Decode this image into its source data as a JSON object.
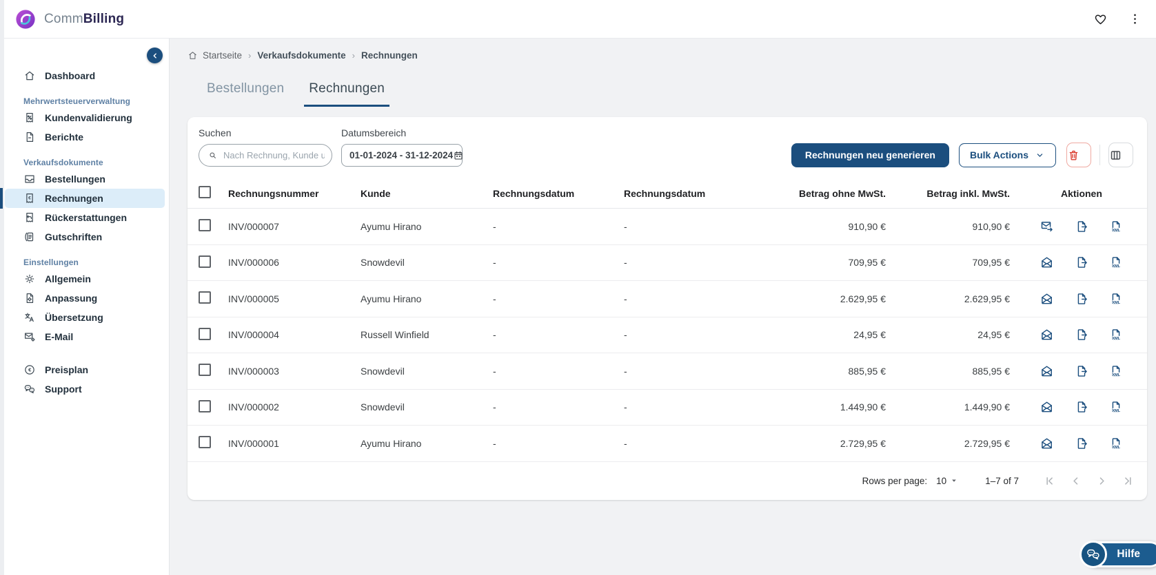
{
  "header": {
    "logo_prefix": "Comm",
    "logo_suffix": "Billing"
  },
  "sidebar": {
    "sections": [
      {
        "header": null,
        "items": [
          {
            "label": "Dashboard",
            "icon": "home-icon"
          }
        ]
      },
      {
        "header": "Mehrwertsteuerverwaltung",
        "items": [
          {
            "label": "Kundenvalidierung",
            "icon": "receipt-percent-icon"
          },
          {
            "label": "Berichte",
            "icon": "document-icon"
          }
        ]
      },
      {
        "header": "Verkaufsdokumente",
        "items": [
          {
            "label": "Bestellungen",
            "icon": "inbox-icon"
          },
          {
            "label": "Rechnungen",
            "icon": "invoice-euro-icon",
            "active": true
          },
          {
            "label": "Rückerstattungen",
            "icon": "refund-icon"
          },
          {
            "label": "Gutschriften",
            "icon": "credit-note-icon"
          }
        ]
      },
      {
        "header": "Einstellungen",
        "items": [
          {
            "label": "Allgemein",
            "icon": "gear-icon"
          },
          {
            "label": "Anpassung",
            "icon": "document-gear-icon"
          },
          {
            "label": "Übersetzung",
            "icon": "translate-icon"
          },
          {
            "label": "E-Mail",
            "icon": "mail-gear-icon"
          }
        ]
      },
      {
        "header": null,
        "gap": true,
        "items": [
          {
            "label": "Preisplan",
            "icon": "euro-circle-icon"
          },
          {
            "label": "Support",
            "icon": "chat-icon"
          }
        ]
      }
    ]
  },
  "breadcrumb": {
    "separator": "›",
    "items": [
      {
        "label": "Startseite",
        "icon": "home-icon",
        "bold": false
      },
      {
        "label": "Verkaufsdokumente",
        "bold": true
      },
      {
        "label": "Rechnungen",
        "bold": true
      }
    ]
  },
  "tabs": [
    {
      "label": "Bestellungen",
      "active": false
    },
    {
      "label": "Rechnungen",
      "active": true
    }
  ],
  "filters": {
    "search_label": "Suchen",
    "search_placeholder": "Nach Rechnung, Kunde u",
    "date_label": "Datumsbereich",
    "date_value": "01-01-2024 - 31-12-2024"
  },
  "toolbar": {
    "regenerate_label": "Rechnungen neu generieren",
    "bulk_label": "Bulk Actions"
  },
  "table": {
    "columns": [
      "Rechnungsnummer",
      "Kunde",
      "Rechnungsdatum",
      "Rechnungsdatum",
      "Betrag ohne MwSt.",
      "Betrag inkl. MwSt.",
      "Aktionen"
    ],
    "rows": [
      {
        "number": "INV/000007",
        "customer": "Ayumu Hirano",
        "date1": "-",
        "date2": "-",
        "net": "910,90 €",
        "gross": "910,90 €",
        "actions": [
          "mail-send-icon",
          "file-export-icon",
          "file-xml-icon"
        ]
      },
      {
        "number": "INV/000006",
        "customer": "Snowdevil",
        "date1": "-",
        "date2": "-",
        "net": "709,95 €",
        "gross": "709,95 €",
        "actions": [
          "mail-open-icon",
          "file-export-icon",
          "file-xml-icon"
        ]
      },
      {
        "number": "INV/000005",
        "customer": "Ayumu Hirano",
        "date1": "-",
        "date2": "-",
        "net": "2.629,95 €",
        "gross": "2.629,95 €",
        "actions": [
          "mail-open-icon",
          "file-export-icon",
          "file-xml-icon"
        ]
      },
      {
        "number": "INV/000004",
        "customer": "Russell Winfield",
        "date1": "-",
        "date2": "-",
        "net": "24,95 €",
        "gross": "24,95 €",
        "actions": [
          "mail-open-icon",
          "file-export-icon",
          "file-xml-icon"
        ]
      },
      {
        "number": "INV/000003",
        "customer": "Snowdevil",
        "date1": "-",
        "date2": "-",
        "net": "885,95 €",
        "gross": "885,95 €",
        "actions": [
          "mail-open-icon",
          "file-export-icon",
          "file-xml-icon"
        ]
      },
      {
        "number": "INV/000002",
        "customer": "Snowdevil",
        "date1": "-",
        "date2": "-",
        "net": "1.449,90 €",
        "gross": "1.449,90 €",
        "actions": [
          "mail-open-icon",
          "file-export-icon",
          "file-xml-icon"
        ]
      },
      {
        "number": "INV/000001",
        "customer": "Ayumu Hirano",
        "date1": "-",
        "date2": "-",
        "net": "2.729,95 €",
        "gross": "2.729,95 €",
        "actions": [
          "mail-open-icon",
          "file-export-icon",
          "file-xml-icon"
        ]
      }
    ]
  },
  "pagination": {
    "rows_per_page_label": "Rows per page:",
    "rows_per_page": "10",
    "range": "1–7 of 7",
    "nav": [
      "first-page-icon",
      "prev-page-icon",
      "next-page-icon",
      "last-page-icon"
    ]
  },
  "help": {
    "label": "Hilfe"
  },
  "colors": {
    "primary": "#1b4e7e",
    "active_item_bg": "#dcedf9",
    "danger": "#d93a2b"
  }
}
